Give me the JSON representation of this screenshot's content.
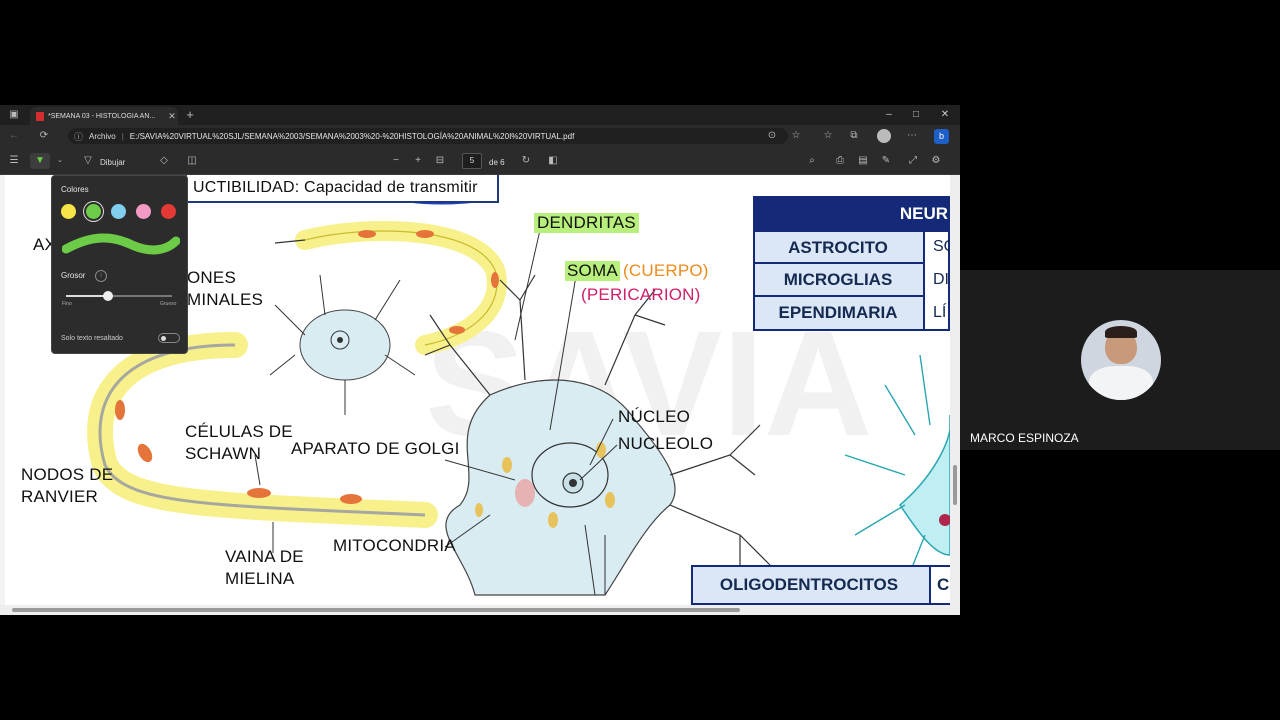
{
  "tab": {
    "title": "*SEMANA 03 - HISTOLOGÍA AN..."
  },
  "window": {
    "minimize": "–",
    "maximize": "□",
    "close": "✕"
  },
  "address": {
    "site_label": "Archivo",
    "url": "E:/SAVIA%20VIRTUAL%20SJL/SEMANA%2003/SEMANA%2003%20-%20HISTOLOGÍA%20ANIMAL%20I%20VIRTUAL.pdf"
  },
  "pdf_toolbar": {
    "draw_label": "Dibujar",
    "page_current": "5",
    "page_total": "de 6"
  },
  "draw_panel": {
    "colors_title": "Colores",
    "colors": [
      "#f7e449",
      "#6ccc48",
      "#80cfee",
      "#f29ac4",
      "#e53935"
    ],
    "selected_color": "#6ccc48",
    "thickness_title": "Grosor",
    "thickness_min": "Fino",
    "thickness_max": "Grueso",
    "thickness_value": 0.4,
    "highlight_only_label": "Solo texto resaltado"
  },
  "doc": {
    "header_text": "UCTIBILIDAD: Capacidad de transmitir",
    "labels": {
      "dendritas": "DENDRITAS",
      "soma": "SOMA",
      "cuerpo": "(CUERPO)",
      "pericarion": "(PERICARION)",
      "axon": "AX",
      "botones1": "ONES",
      "botones2": "MINALES",
      "nucleo": "NÚCLEO",
      "nucleolo": "NUCLEOLO",
      "celulas1": "CÉLULAS DE",
      "celulas2": "SCHAWN",
      "golgi": "APARATO DE GOLGI",
      "nodos1": "NODOS DE",
      "nodos2": "RANVIER",
      "mitocondria": "MITOCONDRIA",
      "vaina1": "VAINA DE",
      "vaina2": "MIELINA"
    },
    "table": {
      "header": "NEUR",
      "rows": [
        {
          "name": "ASTROCITO",
          "desc": "SO"
        },
        {
          "name": "MICROGLIAS",
          "desc": "DI"
        },
        {
          "name": "EPENDIMARIA",
          "desc": "LÍ"
        }
      ]
    },
    "oligo": {
      "name": "OLIGODENTROCITOS",
      "desc": "C"
    }
  },
  "participant": {
    "name": "MARCO ESPINOZA"
  }
}
